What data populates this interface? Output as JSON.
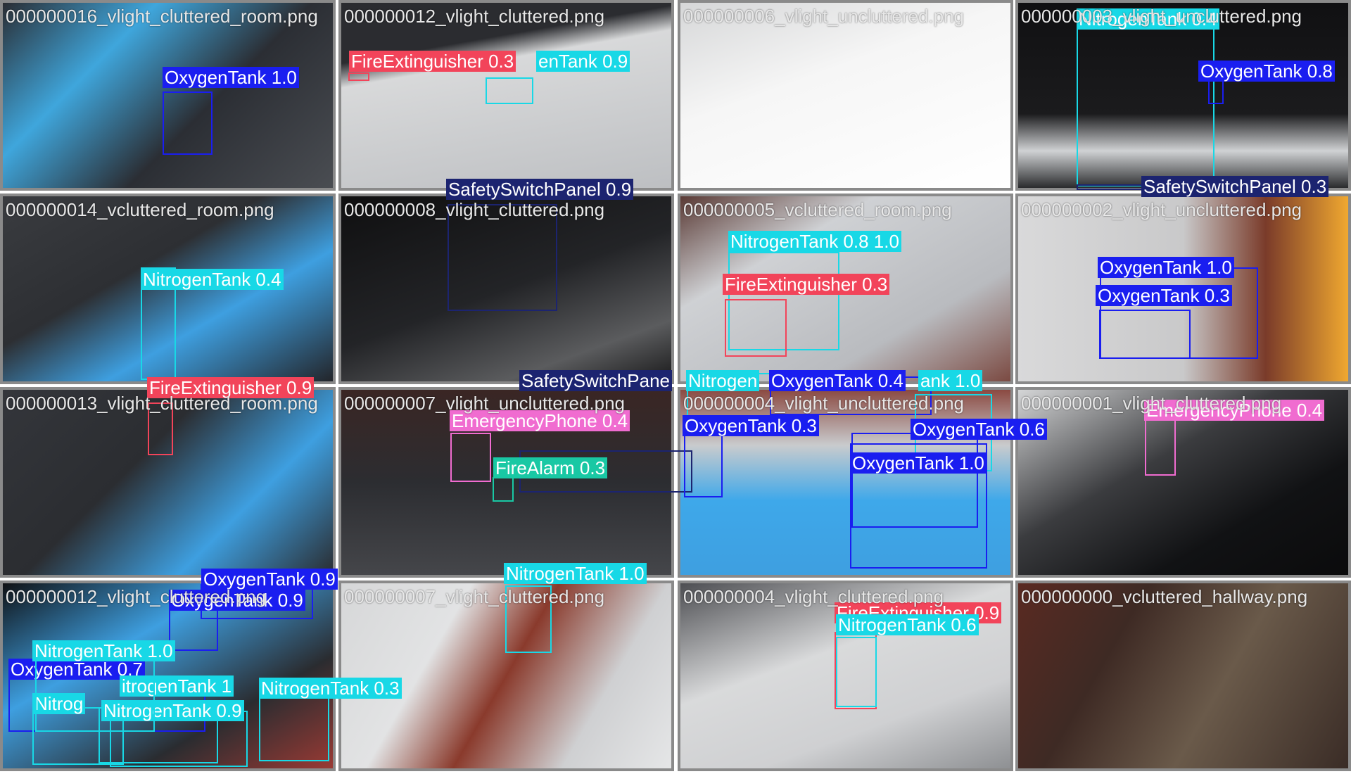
{
  "colors": {
    "OxygenTank": "#1a1ef0",
    "NitrogenTank": "#18d8e6",
    "FireExtinguisher": "#f2445a",
    "SafetySwitchPanel": "#1c2470",
    "EmergencyPhone": "#f06cd0",
    "FireAlarm": "#19c8a4"
  },
  "tiles": [
    {
      "filename": "000000016_vlight_cluttered_room.png",
      "bg": "linear-gradient(135deg,#2a2d33 0%,#3fa6dc 30%,#2b2e34 60%,#4a4d52 100%)"
    },
    {
      "filename": "000000012_vlight_cluttered.png",
      "bg": "linear-gradient(170deg,#2b2c30 0%,#2b2c30 25%,#d8d9da 35%,#bdbfc2 100%)"
    },
    {
      "filename": "000000006_vlight_uncluttered.png",
      "bg": "linear-gradient(160deg,#d6d7d8 0%,#f6f6f6 40%,#ffffff 100%)"
    },
    {
      "filename": "000000003_vlight_uncluttered.png",
      "bg": "linear-gradient(180deg,#101012 0%,#1b1b1d 60%,#d0d2d4 80%,#2a2b2d 100%)"
    },
    {
      "filename": "000000014_vcluttered_room.png",
      "bg": "linear-gradient(150deg,#3a3c40 0%,#2d2f33 40%,#3e9fe0 65%,#23252a 100%)"
    },
    {
      "filename": "000000008_vlight_cluttered.png",
      "bg": "linear-gradient(160deg,#0f0f10 0%,#232427 50%,#5b5c5e 80%,#1a1a1b 100%)"
    },
    {
      "filename": "000000005_vcluttered_room.png",
      "bg": "linear-gradient(150deg,#5a3a35 0%,#cfd1d4 30%,#b9bbbf 70%,#7b4a42 100%)"
    },
    {
      "filename": "000000002_vlight_uncluttered.png",
      "bg": "linear-gradient(90deg,#d9d9da 0%,#c9c9ca 50%,#7a3b2a 75%,#f0a830 100%)"
    },
    {
      "filename": "000000013_vlight_cluttered_room.png",
      "bg": "linear-gradient(135deg,#34363b 0%,#2b2d31 40%,#3e9fe0 70%,#2a2c30 100%)"
    },
    {
      "filename": "000000007_vlight_uncluttered.png",
      "bg": "linear-gradient(180deg,#3a2624 0%,#2c2d31 50%,#45464a 100%)"
    },
    {
      "filename": "000000004_vlight_uncluttered.png",
      "bg": "linear-gradient(180deg,#8b4a42 0%,#c9cbcd 30%,#3ea8ea 60%,#3e9fe0 100%)"
    },
    {
      "filename": "000000001_vlight_cluttered.png",
      "bg": "linear-gradient(150deg,#d4d5d6 0%,#3b3c3f 40%,#111214 70%,#0b0b0c 100%)"
    },
    {
      "filename": "000000012_vlight_cluttered.png",
      "bg": "linear-gradient(150deg,#101114 0%,#3e9fe0 35%,#2a2c30 70%,#9a3a34 100%)"
    },
    {
      "filename": "000000007_vlight_cluttered.png",
      "bg": "linear-gradient(120deg,#d6d7d8 0%,#e2e3e4 30%,#8a3a2c 50%,#cfd0d2 75%,#e5e6e7 100%)"
    },
    {
      "filename": "000000004_vlight_cluttered.png",
      "bg": "linear-gradient(160deg,#4d4e52 0%,#d9dadb 40%,#cfd0d2 70%,#8e9093 100%)"
    },
    {
      "filename": "000000000_vcluttered_hallway.png",
      "bg": "linear-gradient(120deg,#5a2a22 0%,#3e2a24 30%,#6a5a4a 60%,#3a2c26 100%)"
    }
  ],
  "detections": [
    {
      "label": "OxygenTank 1.0",
      "cls": "OxygenTank"
    },
    {
      "label": "FireExtinguisher 0.3",
      "cls": "FireExtinguisher"
    },
    {
      "label": "enTank 0.9",
      "cls": "NitrogenTank"
    },
    {
      "label": "NitrogenTank 0.4",
      "cls": "NitrogenTank"
    },
    {
      "label": "OxygenTank 0.8",
      "cls": "OxygenTank"
    },
    {
      "label": "SafetySwitchPanel 0.9",
      "cls": "SafetySwitchPanel"
    },
    {
      "label": "SafetySwitchPanel 0.3",
      "cls": "SafetySwitchPanel"
    },
    {
      "label": "NitrogenTank 0.4",
      "cls": "NitrogenTank"
    },
    {
      "label": "NitrogenTank 0.8 1.0",
      "cls": "NitrogenTank"
    },
    {
      "label": "FireExtinguisher 0.3",
      "cls": "FireExtinguisher"
    },
    {
      "label": "OxygenTank 1.0",
      "cls": "OxygenTank"
    },
    {
      "label": "OxygenTank 0.3",
      "cls": "OxygenTank"
    },
    {
      "label": "FireExtinguisher 0.9",
      "cls": "FireExtinguisher"
    },
    {
      "label": "SafetySwitchPane",
      "cls": "SafetySwitchPanel"
    },
    {
      "label": "Nitrogen",
      "cls": "NitrogenTank"
    },
    {
      "label": "OxygenTank 0.4",
      "cls": "OxygenTank"
    },
    {
      "label": "ank 1.0",
      "cls": "NitrogenTank"
    },
    {
      "label": "EmergencyPhone 0.4",
      "cls": "EmergencyPhone"
    },
    {
      "label": "FireAlarm 0.3",
      "cls": "FireAlarm"
    },
    {
      "label": "OxygenTank 0.3",
      "cls": "OxygenTank"
    },
    {
      "label": "OxygenTank 0.6",
      "cls": "OxygenTank"
    },
    {
      "label": "OxygenTank 1.0",
      "cls": "OxygenTank"
    },
    {
      "label": "EmergencyPhone 0.4",
      "cls": "EmergencyPhone"
    },
    {
      "label": "OxygenTank 0.9",
      "cls": "OxygenTank"
    },
    {
      "label": "OxygenTank 0.9",
      "cls": "OxygenTank"
    },
    {
      "label": "NitrogenTank 1.0",
      "cls": "NitrogenTank"
    },
    {
      "label": "OxygenTank 0.7",
      "cls": "OxygenTank"
    },
    {
      "label": "itrogenTank 1",
      "cls": "NitrogenTank"
    },
    {
      "label": "NitrogenTank 0.3",
      "cls": "NitrogenTank"
    },
    {
      "label": "Nitrog",
      "cls": "NitrogenTank"
    },
    {
      "label": "NitrogenTank 0.9",
      "cls": "NitrogenTank"
    },
    {
      "label": "NitrogenTank 1.0",
      "cls": "NitrogenTank"
    },
    {
      "label": "FireExtinguisher 0.9",
      "cls": "FireExtinguisher"
    },
    {
      "label": "NitrogenTank 0.6",
      "cls": "NitrogenTank"
    }
  ]
}
